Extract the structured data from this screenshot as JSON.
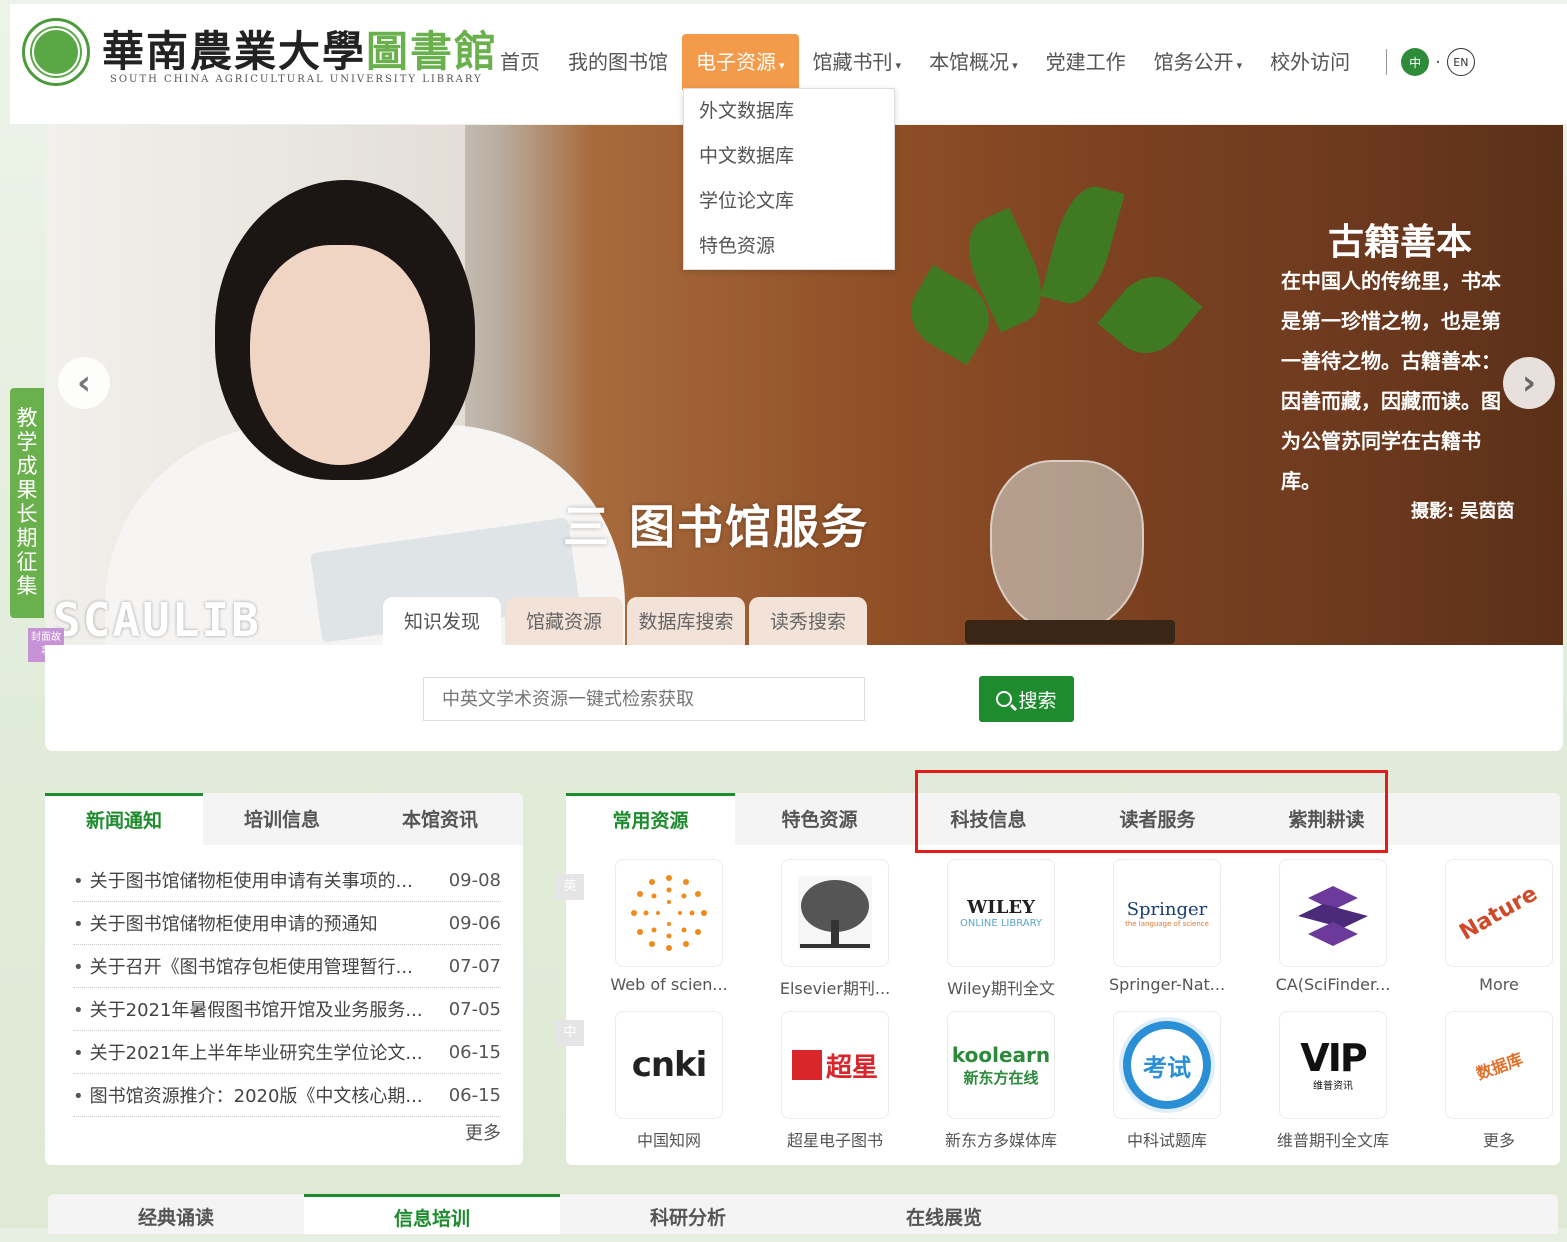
{
  "header": {
    "logo_text": "華南農業大學",
    "logo_text_green": "圖書館",
    "logo_sub": "SOUTH CHINA AGRICULTURAL UNIVERSITY LIBRARY",
    "nav": [
      {
        "label": "首页",
        "caret": false
      },
      {
        "label": "我的图书馆",
        "caret": false
      },
      {
        "label": "电子资源",
        "caret": true,
        "active": true
      },
      {
        "label": "馆藏书刊",
        "caret": true
      },
      {
        "label": "本馆概况",
        "caret": true
      },
      {
        "label": "党建工作",
        "caret": false
      },
      {
        "label": "馆务公开",
        "caret": true
      },
      {
        "label": "校外访问",
        "caret": false
      }
    ],
    "lang_cn": "中",
    "lang_en": "EN"
  },
  "dropdown": [
    "外文数据库",
    "中文数据库",
    "学位论文库",
    "特色资源"
  ],
  "banner": {
    "title": "古籍善本",
    "desc": "在中国人的传统里，书本是第一珍惜之物，也是第一善待之物。古籍善本：因善而藏，因藏而读。图为公管苏同学在古籍书库。",
    "credit": "摄影: 吴茵茵",
    "overlay": "三  图书馆服务",
    "brand": "SCAULIB",
    "prev": "‹",
    "next": "›"
  },
  "search": {
    "tabs": [
      "知识发现",
      "馆藏资源",
      "数据库搜索",
      "读秀搜索"
    ],
    "placeholder": "中英文学术资源一键式检索获取",
    "button": "搜索"
  },
  "side_tab": "教学成果长期征集",
  "side_badge": "封面故事",
  "news": {
    "tabs": [
      "新闻通知",
      "培训信息",
      "本馆资讯"
    ],
    "items": [
      {
        "title": "关于图书馆储物柜使用申请有关事项的...",
        "date": "09-08"
      },
      {
        "title": "关于图书馆储物柜使用申请的预通知",
        "date": "09-06"
      },
      {
        "title": "关于召开《图书馆存包柜使用管理暂行...",
        "date": "07-07"
      },
      {
        "title": "关于2021年暑假图书馆开馆及业务服务...",
        "date": "07-05"
      },
      {
        "title": "关于2021年上半年毕业研究生学位论文...",
        "date": "06-15"
      },
      {
        "title": "图书馆资源推介：2020版《中文核心期...",
        "date": "06-15"
      }
    ],
    "more": "更多"
  },
  "resources": {
    "tabs": [
      "常用资源",
      "特色资源",
      "科技信息",
      "读者服务",
      "紫荆耕读"
    ],
    "row_labels": [
      "英",
      "中"
    ],
    "items": [
      {
        "name": "Web of scien...",
        "logo": "web-of-science"
      },
      {
        "name": "Elsevier期刊...",
        "logo": "elsevier",
        "logo_text": ""
      },
      {
        "name": "Wiley期刊全文",
        "logo": "wiley",
        "logo_text": "WILEY",
        "logo_sub": "ONLINE LIBRARY"
      },
      {
        "name": "Springer-Nat...",
        "logo": "springer",
        "logo_text": "Springer",
        "logo_sub": "the language of science"
      },
      {
        "name": "CA(SciFinder...",
        "logo": "scifinder"
      },
      {
        "name": "More",
        "logo": "more-cloud",
        "logo_text": "Nature"
      },
      {
        "name": "中国知网",
        "logo": "cnki",
        "logo_text": "cnki"
      },
      {
        "name": "超星电子图书",
        "logo": "chaoxing",
        "logo_text": "超星"
      },
      {
        "name": "新东方多媒体库",
        "logo": "koolearn",
        "logo_text": "koolearn",
        "logo_sub": "新东方在线"
      },
      {
        "name": "中科试题库",
        "logo": "kaoshi",
        "logo_text": "考试"
      },
      {
        "name": "维普期刊全文库",
        "logo": "vip",
        "logo_text": "VIP",
        "logo_sub": "维普资讯"
      },
      {
        "name": "更多",
        "logo": "more-cloud-cn",
        "logo_text": "数据库"
      }
    ]
  },
  "bottom_tabs": [
    "经典诵读",
    "信息培训",
    "科研分析",
    "在线展览"
  ],
  "colors": {
    "accent_green": "#1e8c2e",
    "nav_active": "#f39a4b",
    "highlight": "#e31b1b"
  }
}
